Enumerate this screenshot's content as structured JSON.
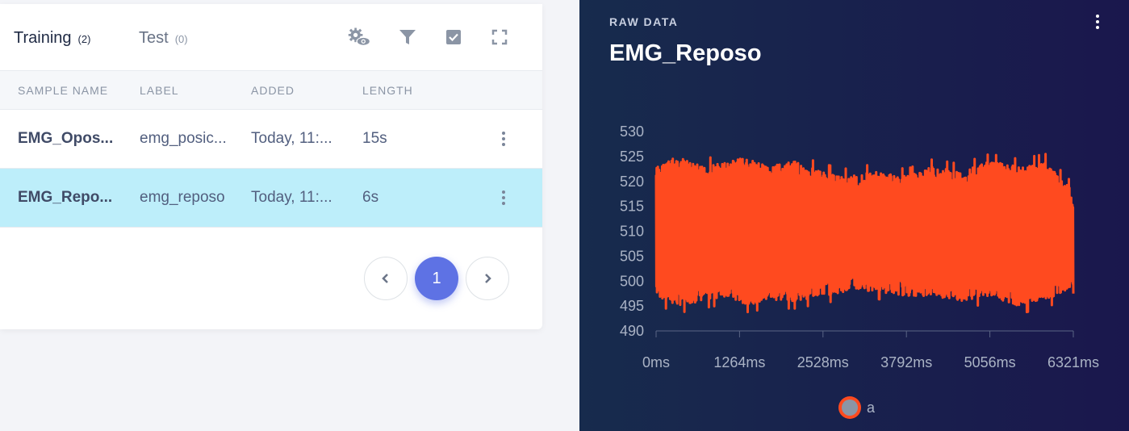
{
  "tabs": [
    {
      "label": "Training",
      "count": "(2)"
    },
    {
      "label": "Test",
      "count": "(0)"
    }
  ],
  "toolbar": {
    "icons": [
      "settings-eye-icon",
      "filter-icon",
      "select-checkbox-icon",
      "fullscreen-icon"
    ]
  },
  "table": {
    "headers": [
      "SAMPLE NAME",
      "LABEL",
      "ADDED",
      "LENGTH"
    ],
    "rows": [
      {
        "name": "EMG_Opos...",
        "label": "emg_posic...",
        "added": "Today, 11:...",
        "length": "15s",
        "selected": false
      },
      {
        "name": "EMG_Repo...",
        "label": "emg_reposo",
        "added": "Today, 11:...",
        "length": "6s",
        "selected": true
      }
    ]
  },
  "pagination": {
    "prev": "‹",
    "current": "1",
    "next": "›"
  },
  "panel": {
    "subtitle": "RAW DATA",
    "title": "EMG_Reposo"
  },
  "colors": {
    "accent": "#5e72e4",
    "series": "#ff4a1f",
    "selected_row": "#bdeefa",
    "panel_bg": "#172b4d"
  },
  "chart_data": {
    "type": "line",
    "title": "",
    "xlabel": "",
    "ylabel": "",
    "ylim": [
      490,
      530
    ],
    "yticks": [
      "490",
      "495",
      "500",
      "505",
      "510",
      "515",
      "520",
      "525",
      "530"
    ],
    "xlim": [
      0,
      6321
    ],
    "xticks": [
      "0ms",
      "1264ms",
      "2528ms",
      "3792ms",
      "5056ms",
      "6321ms"
    ],
    "grid": false,
    "legend": "bottom",
    "series": [
      {
        "name": "a",
        "envelope": {
          "x": [
            0,
            300,
            700,
            1100,
            1264,
            1700,
            2100,
            2528,
            2900,
            3300,
            3792,
            4200,
            4600,
            5056,
            5500,
            5900,
            6321
          ],
          "max": [
            523,
            525,
            523,
            524,
            525,
            523,
            524,
            522,
            521,
            522,
            521,
            523,
            522,
            524,
            523,
            524,
            518
          ],
          "min": [
            497,
            495,
            496,
            497,
            495,
            496,
            496,
            497,
            498,
            498,
            497,
            497,
            496,
            497,
            495,
            496,
            499
          ]
        },
        "center": 510
      }
    ]
  }
}
